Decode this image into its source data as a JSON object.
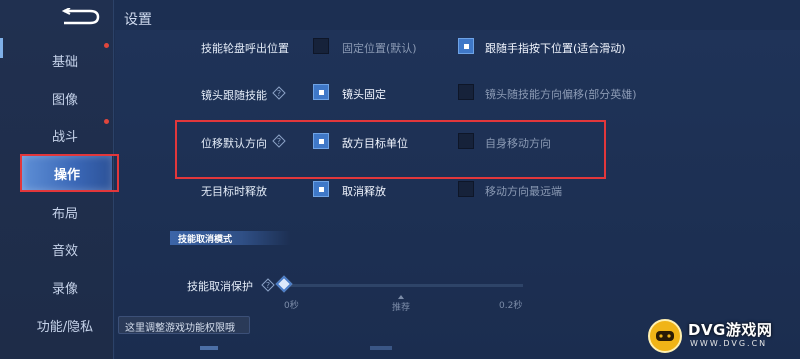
{
  "header": {
    "title": "设置"
  },
  "sidebar": {
    "items": [
      {
        "label": "基础",
        "has_dot": true
      },
      {
        "label": "图像",
        "has_dot": false
      },
      {
        "label": "战斗",
        "has_dot": true
      },
      {
        "label": "操作",
        "active": true
      },
      {
        "label": "布局"
      },
      {
        "label": "音效"
      },
      {
        "label": "录像"
      },
      {
        "label": "功能/隐私"
      }
    ]
  },
  "settings": {
    "row1": {
      "label": "技能轮盘呼出位置",
      "option_a": {
        "label": "固定位置(默认)",
        "checked": false
      },
      "option_b": {
        "label": "跟随手指按下位置(适合滑动)",
        "checked": true
      }
    },
    "row2": {
      "label": "镜头跟随技能",
      "option_a": {
        "label": "镜头固定",
        "checked": true
      },
      "option_b": {
        "label": "镜头随技能方向偏移(部分英雄)",
        "checked": false
      }
    },
    "row3": {
      "label": "位移默认方向",
      "option_a": {
        "label": "敌方目标单位",
        "checked": true
      },
      "option_b": {
        "label": "自身移动方向",
        "checked": false
      }
    },
    "row4": {
      "label": "无目标时释放",
      "option_a": {
        "label": "取消释放",
        "checked": true
      },
      "option_b": {
        "label": "移动方向最远端",
        "checked": false
      }
    }
  },
  "section": {
    "title": "技能取消模式"
  },
  "slider": {
    "label": "技能取消保护",
    "value": 0,
    "ticks": [
      "0秒",
      "推荐",
      "0.2秒"
    ]
  },
  "tooltip": {
    "text": "这里调整游戏功能权限哦"
  },
  "watermark": {
    "text": "DVG游戏网",
    "sub": "WWW.DVG.CN"
  },
  "colors": {
    "accent": "#3f78c8",
    "highlight_box": "#e2373b",
    "background": "#1c2f52"
  }
}
